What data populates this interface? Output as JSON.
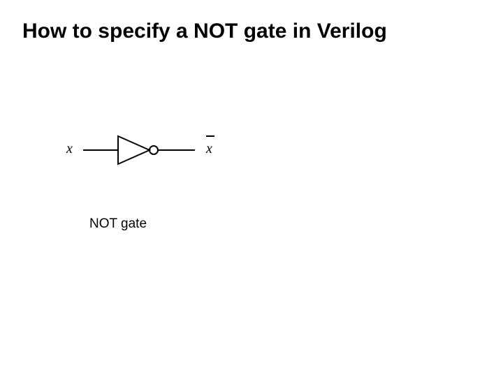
{
  "title": "How to specify a NOT gate in Verilog",
  "diagram": {
    "input_label": "x",
    "output_label": "x",
    "gate_name": "NOT gate"
  }
}
